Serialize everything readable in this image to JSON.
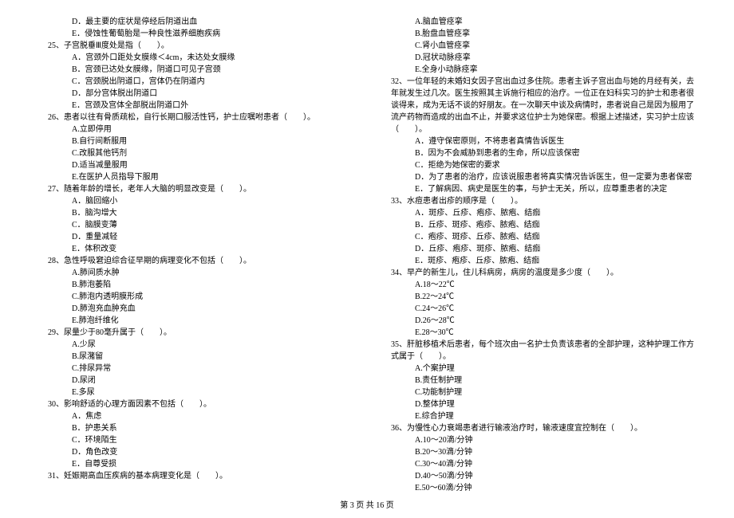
{
  "left": {
    "q24_d": "D．最主要的症状是停经后阴道出血",
    "q24_e": "E．侵蚀性葡萄胎是一种良性滋养细胞疾病",
    "q25": "25、子宫脱垂Ⅲ度处是指（　　）。",
    "q25_a": "A．宫颈外口距处女膜缘＜4cm，未达处女膜缘",
    "q25_b": "B．宫颈已达处女膜缘，阴道口可见子宫颈",
    "q25_c": "C．宫颈脱出阴道口，宫体仍在阴道内",
    "q25_d": "D．部分宫体脱出阴道口",
    "q25_e": "E．宫颈及宫体全部脱出阴道口外",
    "q26": "26、患者以往有骨质疏松，自行长期口服活性钙，护士应嘱咐患者（　　）。",
    "q26_a": "A.立即停用",
    "q26_b": "B.自行间断服用",
    "q26_c": "C.改服其他钙剂",
    "q26_d": "D.适当减量服用",
    "q26_e": "E.在医护人员指导下服用",
    "q27": "27、随着年龄的增长，老年人大脑的明显改变是（　　）。",
    "q27_a": "A．脑回缩小",
    "q27_b": "B．脑沟增大",
    "q27_c": "C．脑膜变薄",
    "q27_d": "D．重量减轻",
    "q27_e": "E．体积改变",
    "q28": "28、急性呼吸窘迫综合征早期的病理变化不包括（　　）。",
    "q28_a": "A.肺间质水肿",
    "q28_b": "B.肺泡萎陷",
    "q28_c": "C.肺泡内透明膜形成",
    "q28_d": "D.肺泡充血肿充血",
    "q28_e": "E.肺泡纤维化",
    "q29": "29、尿量少于80毫升属于（　　）。",
    "q29_a": "A.少尿",
    "q29_b": "B.尿潴留",
    "q29_c": "C.排尿异常",
    "q29_d": "D.尿闭",
    "q29_e": "E.多尿",
    "q30": "30、影响舒适的心理方面因素不包括（　　）。",
    "q30_a": "A．焦虑",
    "q30_b": "B．护患关系",
    "q30_c": "C．环境陌生",
    "q30_d": "D．角色改变",
    "q30_e": "E．自尊受损",
    "q31": "31、妊娠期高血压疾病的基本病理变化是（　　）。"
  },
  "right": {
    "q31_a": "A.脑血管痉挛",
    "q31_b": "B.胎盘血管痉挛",
    "q31_c": "C.肾小血管痉挛",
    "q31_d": "D.冠状动脉痉挛",
    "q31_e": "E.全身小动脉痉挛",
    "q32": "32、一位年轻的未婚妇女因子宫出血过多住院。患者主诉子宫出血与她的月经有关，去年就发生过几次。医生按照其主诉施行相应的治疗。一位正在妇科实习的护士和患者很谈得来，成为无话不谈的好朋友。在一次聊天中谈及病情时，患者说自己是因为服用了流产药物而造成的出血不止，并要求这位护士为她保密。根据上述描述，实习护士应该（　　）。",
    "q32_a": "A．遵守保密原则，不将患者真情告诉医生",
    "q32_b": "B．因为不会威胁到患者的生命，所以应该保密",
    "q32_c": "C．拒绝为她保密的要求",
    "q32_d": "D．为了患者的治疗，应该说服患者将真实情况告诉医生，但一定要为患者保密",
    "q32_e": "E．了解病因、病史是医生的事，与护士无关，所以，应尊重患者的决定",
    "q33": "33、水痘患者出疹的顺序是（　　）。",
    "q33_a": "A．斑疹、丘疹、疱疹、脓疱、结痂",
    "q33_b": "B．丘疹、斑疹、疱疹、脓疱、结痂",
    "q33_c": "C．疱疹、斑疹、丘疹、脓疱、结痂",
    "q33_d": "D．丘疹、疱疹、斑疹、脓疱、结痂",
    "q33_e": "E．斑疹、疱疹、丘疹、脓疱、结痂",
    "q34": "34、早产的新生儿，住儿科病房，病房的温度是多少度（　　）。",
    "q34_a": "A.18～22℃",
    "q34_b": "B.22～24℃",
    "q34_c": "C.24～26℃",
    "q34_d": "D.26～28℃",
    "q34_e": "E.28～30℃",
    "q35": "35、肝脏移植术后患者，每个班次由一名护士负责该患者的全部护理，这种护理工作方式属于（　　）。",
    "q35_a": "A.个案护理",
    "q35_b": "B.责任制护理",
    "q35_c": "C.功能制护理",
    "q35_d": "D.整体护理",
    "q35_e": "E.综合护理",
    "q36": "36、为慢性心力衰竭患者进行输液治疗时，输液速度宜控制在（　　）。",
    "q36_a": "A.10～20滴/分钟",
    "q36_b": "B.20～30滴/分钟",
    "q36_c": "C.30～40滴/分钟",
    "q36_d": "D.40～50滴/分钟",
    "q36_e": "E.50～60滴/分钟"
  },
  "footer": "第 3 页 共 16 页"
}
